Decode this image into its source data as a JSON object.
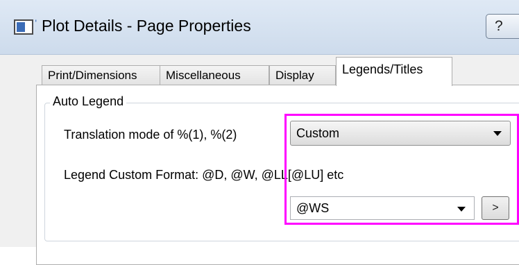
{
  "window": {
    "title": "Plot Details - Page Properties",
    "help_label": "?"
  },
  "tabs": [
    {
      "label": "Print/Dimensions",
      "active": false
    },
    {
      "label": "Miscellaneous",
      "active": false
    },
    {
      "label": "Display",
      "active": false
    },
    {
      "label": "Legends/Titles",
      "active": true
    }
  ],
  "auto_legend": {
    "group_title": "Auto Legend",
    "translation_label": "Translation mode of %(1), %(2)",
    "translation_value": "Custom",
    "format_label": "Legend Custom Format: @D, @W, @LL[@LU] etc",
    "format_value": "@WS",
    "browse_label": ">"
  },
  "colors": {
    "highlight": "#ff00ff"
  }
}
